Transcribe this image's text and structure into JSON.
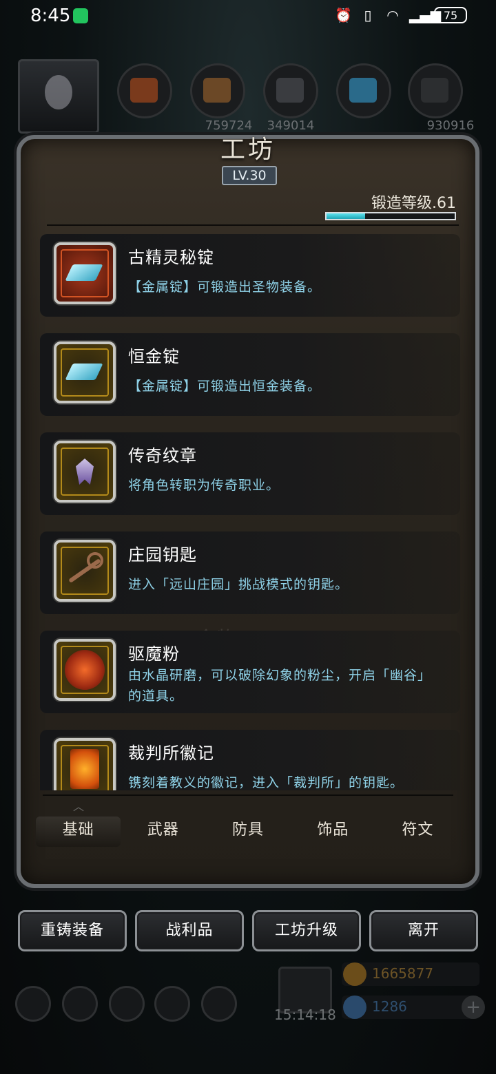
{
  "status_bar": {
    "time": "8:45",
    "battery": "75"
  },
  "resources": {
    "values": [
      "",
      "",
      "759724",
      "349014",
      "",
      "930916"
    ]
  },
  "panel": {
    "title": "工坊",
    "level": "LV.30",
    "forge_level_label": "锻造等级.61",
    "forge_progress": 0.3
  },
  "items": [
    {
      "title": "古精灵秘锭",
      "desc": "【金属锭】可锻造出圣物装备。",
      "icon": "silver-ingot-icon"
    },
    {
      "title": "恒金锭",
      "desc": "【金属锭】可锻造出恒金装备。",
      "icon": "ingot-icon"
    },
    {
      "title": "传奇纹章",
      "desc": "将角色转职为传奇职业。",
      "icon": "crest-icon"
    },
    {
      "title": "庄园钥匙",
      "desc": "进入「远山庄园」挑战模式的钥匙。",
      "icon": "key-icon"
    },
    {
      "title": "驱魔粉",
      "desc": "由水晶研磨，可以破除幻象的粉尘，开启「幽谷」的道具。",
      "icon": "powder-icon"
    },
    {
      "title": "裁判所徽记",
      "desc": "镌刻着教义的徽记，进入「裁判所」的钥匙。",
      "icon": "emblem-icon"
    }
  ],
  "ghost_text": "食物 +400",
  "tabs": [
    "基础",
    "武器",
    "防具",
    "饰品",
    "符文"
  ],
  "active_tab": 0,
  "buttons": [
    "重铸装备",
    "战利品",
    "工坊升级",
    "离开"
  ],
  "hud": {
    "timer": "15:14:18",
    "gold": "1665877",
    "gems": "1286"
  }
}
